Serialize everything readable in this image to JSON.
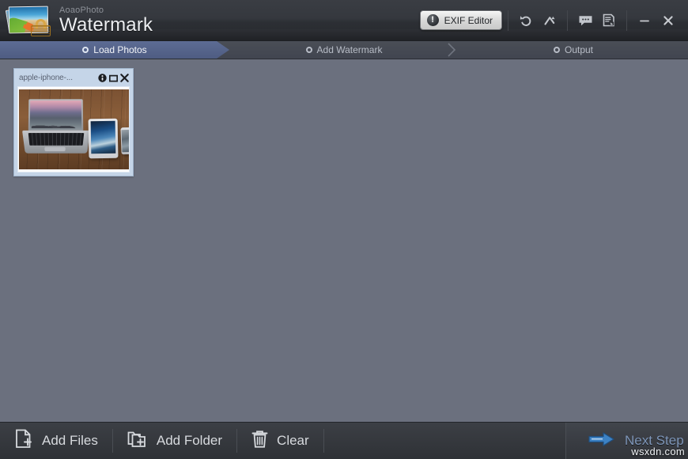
{
  "window": {
    "brand_sub": "AoaoPhoto",
    "brand_main": "Watermark",
    "logo_icon": "photo-lock-icon"
  },
  "titlebar": {
    "exif_button": {
      "label": "EXIF Editor",
      "icon": "exclamation-circle-icon"
    },
    "tools": [
      {
        "name": "undo-icon",
        "title": "Undo"
      },
      {
        "name": "redo-arrow-icon",
        "title": "Redo"
      },
      {
        "name": "comment-bubble-icon",
        "title": "Feedback"
      },
      {
        "name": "register-document-icon",
        "title": "Register"
      }
    ],
    "minimize_label": "–",
    "close_label": "✕"
  },
  "steps": [
    {
      "label": "Load Photos",
      "active": true
    },
    {
      "label": "Add Watermark",
      "active": false
    },
    {
      "label": "Output",
      "active": false
    }
  ],
  "main": {
    "background_color": "#6b707e",
    "thumbnails": [
      {
        "filename": "apple-iphone-...",
        "actions": [
          {
            "name": "info-icon",
            "glyph": "i"
          },
          {
            "name": "maximize-preview-icon",
            "glyph": "▭"
          },
          {
            "name": "remove-icon",
            "glyph": "✕"
          }
        ],
        "image_description": "laptop-tablet-phone-on-wood-desk"
      }
    ]
  },
  "bottombar": {
    "buttons": [
      {
        "label": "Add Files",
        "icon": "file-plus-icon"
      },
      {
        "label": "Add Folder",
        "icon": "folder-plus-icon"
      },
      {
        "label": "Clear",
        "icon": "trash-icon"
      }
    ],
    "next": {
      "label": "Next Step",
      "icon": "arrow-right-icon",
      "color": "#7d95b8"
    }
  },
  "watermark": {
    "text": "wsxdn.com"
  }
}
